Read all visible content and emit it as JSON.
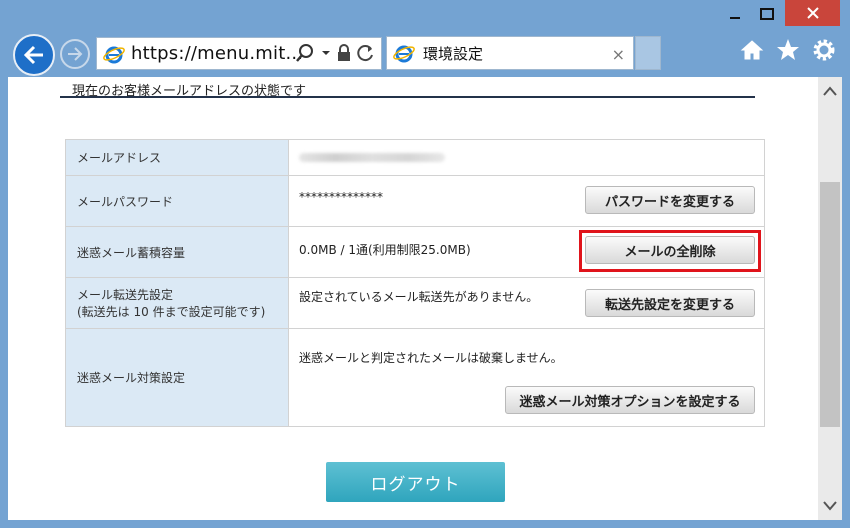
{
  "browser": {
    "url": "https://menu.mit...",
    "tab_title": "環境設定",
    "tab_close": "×"
  },
  "page": {
    "section_title": "現在のお客様メールアドレスの状態です",
    "rows": [
      {
        "label": "メールアドレス",
        "value": ""
      },
      {
        "label": "メールパスワード",
        "value": "**************",
        "button": "パスワードを変更する"
      },
      {
        "label": "迷惑メール蓄積容量",
        "value": "0.0MB / 1通(利用制限25.0MB)",
        "button": "メールの全削除"
      },
      {
        "label_line1": "メール転送先設定",
        "label_line2": "(転送先は 10 件まで設定可能です)",
        "value": "設定されているメール転送先がありません。",
        "button": "転送先設定を変更する"
      },
      {
        "label": "迷惑メール対策設定",
        "value": "迷惑メールと判定されたメールは破棄しません。",
        "button": "迷惑メール対策オプションを設定する"
      }
    ],
    "logout_label": "ログアウト"
  },
  "colors": {
    "frame": "#74a3d2",
    "label_bg": "#dbe9f5",
    "highlight": "#e0141b",
    "logout": "#3aafc5"
  }
}
